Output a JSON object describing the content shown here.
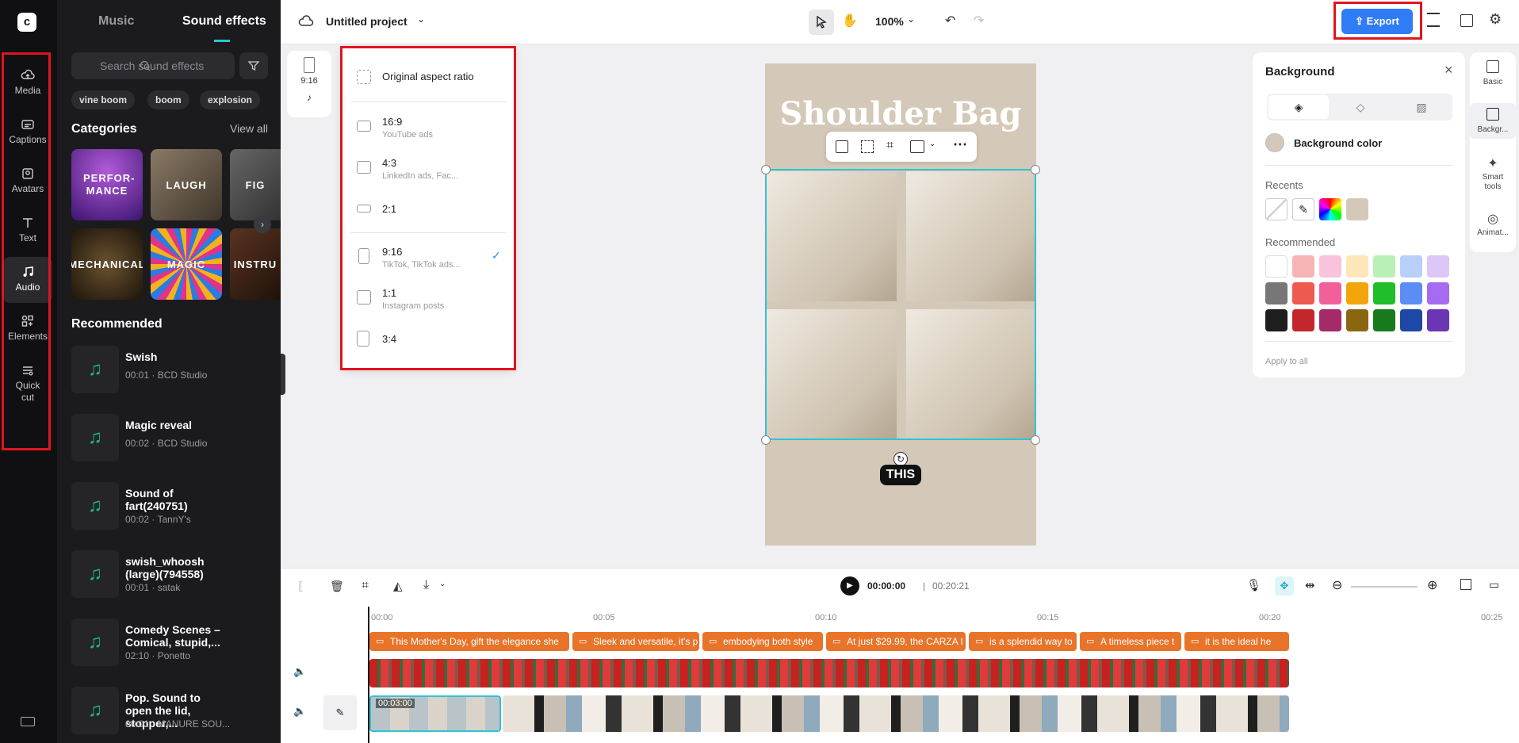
{
  "rail": {
    "items": [
      {
        "label": "Media",
        "icon": "cloud-upload-icon"
      },
      {
        "label": "Captions",
        "icon": "captions-icon"
      },
      {
        "label": "Avatars",
        "icon": "avatar-icon"
      },
      {
        "label": "Text",
        "icon": "text-icon"
      },
      {
        "label": "Audio",
        "icon": "music-note-icon",
        "active": true
      },
      {
        "label": "Elements",
        "icon": "elements-icon"
      },
      {
        "label": "Quick cut",
        "icon": "quick-cut-icon"
      }
    ]
  },
  "panel": {
    "tabs": [
      "Music",
      "Sound effects"
    ],
    "active_tab": "Sound effects",
    "search_placeholder": "Search sound effects",
    "chips": [
      "vine boom",
      "boom",
      "explosion"
    ],
    "categories_title": "Categories",
    "view_all": "View all",
    "categories": [
      "PERFOR-MANCE",
      "LAUGH",
      "FIG",
      "MECHANICAL",
      "MAGIC",
      "INSTRU"
    ],
    "recommended_title": "Recommended",
    "tracks": [
      {
        "title": "Swish",
        "meta": "00:01 · BCD Studio"
      },
      {
        "title": "Magic reveal",
        "meta": "00:02 · BCD Studio"
      },
      {
        "title": "Sound of fart(240751)",
        "meta": "00:02 · TannY's"
      },
      {
        "title": "swish_whoosh (large)(794558)",
        "meta": "00:01 · satak"
      },
      {
        "title": "Comedy Scenes – Comical, stupid,...",
        "meta": "02:10 · Ponetto"
      },
      {
        "title": "Pop. Sound to open the lid, stopper,...",
        "meta": "00:01 · MANURE SOU..."
      }
    ]
  },
  "topbar": {
    "project_name": "Untitled project",
    "zoom": "100%",
    "export_label": "Export"
  },
  "ratio_button": {
    "label": "9:16"
  },
  "aspect_menu": {
    "items": [
      {
        "label": "Original aspect ratio",
        "sub": ""
      },
      {
        "label": "16:9",
        "sub": "YouTube ads"
      },
      {
        "label": "4:3",
        "sub": "LinkedIn ads, Fac..."
      },
      {
        "label": "2:1",
        "sub": ""
      },
      {
        "label": "9:16",
        "sub": "TikTok, TikTok ads...",
        "selected": true
      },
      {
        "label": "1:1",
        "sub": "Instagram posts"
      },
      {
        "label": "3:4",
        "sub": ""
      }
    ]
  },
  "canvas": {
    "title": "Shoulder Bag",
    "caption_word": "THIS",
    "background_color": "#d4c9b8"
  },
  "background_panel": {
    "title": "Background",
    "color_label": "Background color",
    "recents_label": "Recents",
    "recommended_label": "Recommended",
    "apply_all": "Apply to all",
    "recent_colors": [
      "none",
      "eyedropper",
      "rainbow",
      "#d4c9b8"
    ],
    "recommended_colors": [
      "#ffffff",
      "#f7b4b4",
      "#f9c3dc",
      "#fde6b8",
      "#b9f0b6",
      "#b8cff9",
      "#dcc8f7",
      "#777777",
      "#ef5a4f",
      "#f2609b",
      "#f2a50b",
      "#1fbe2a",
      "#5b8df5",
      "#a56cf2",
      "#1e1e1e",
      "#c2272c",
      "#a52a6a",
      "#8a6512",
      "#177a1d",
      "#1e48a8",
      "#6a36b6"
    ]
  },
  "right_rail": {
    "items": [
      "Basic",
      "Backgr...",
      "Smart tools",
      "Animat..."
    ]
  },
  "timeline": {
    "current_time": "00:00:00",
    "total_time": "00:20:21",
    "ticks": [
      "00:00",
      "00:05",
      "00:10",
      "00:15",
      "00:20",
      "00:25"
    ],
    "clip_duration": "00:03:00",
    "text_clips": [
      "This Mother's Day, gift the elegance she",
      "Sleek and versatile, it's p",
      "embodying both style",
      "At just $29.99, the CARZA I",
      "is a splendid way to",
      "A timeless piece t",
      "it is the ideal he"
    ]
  }
}
